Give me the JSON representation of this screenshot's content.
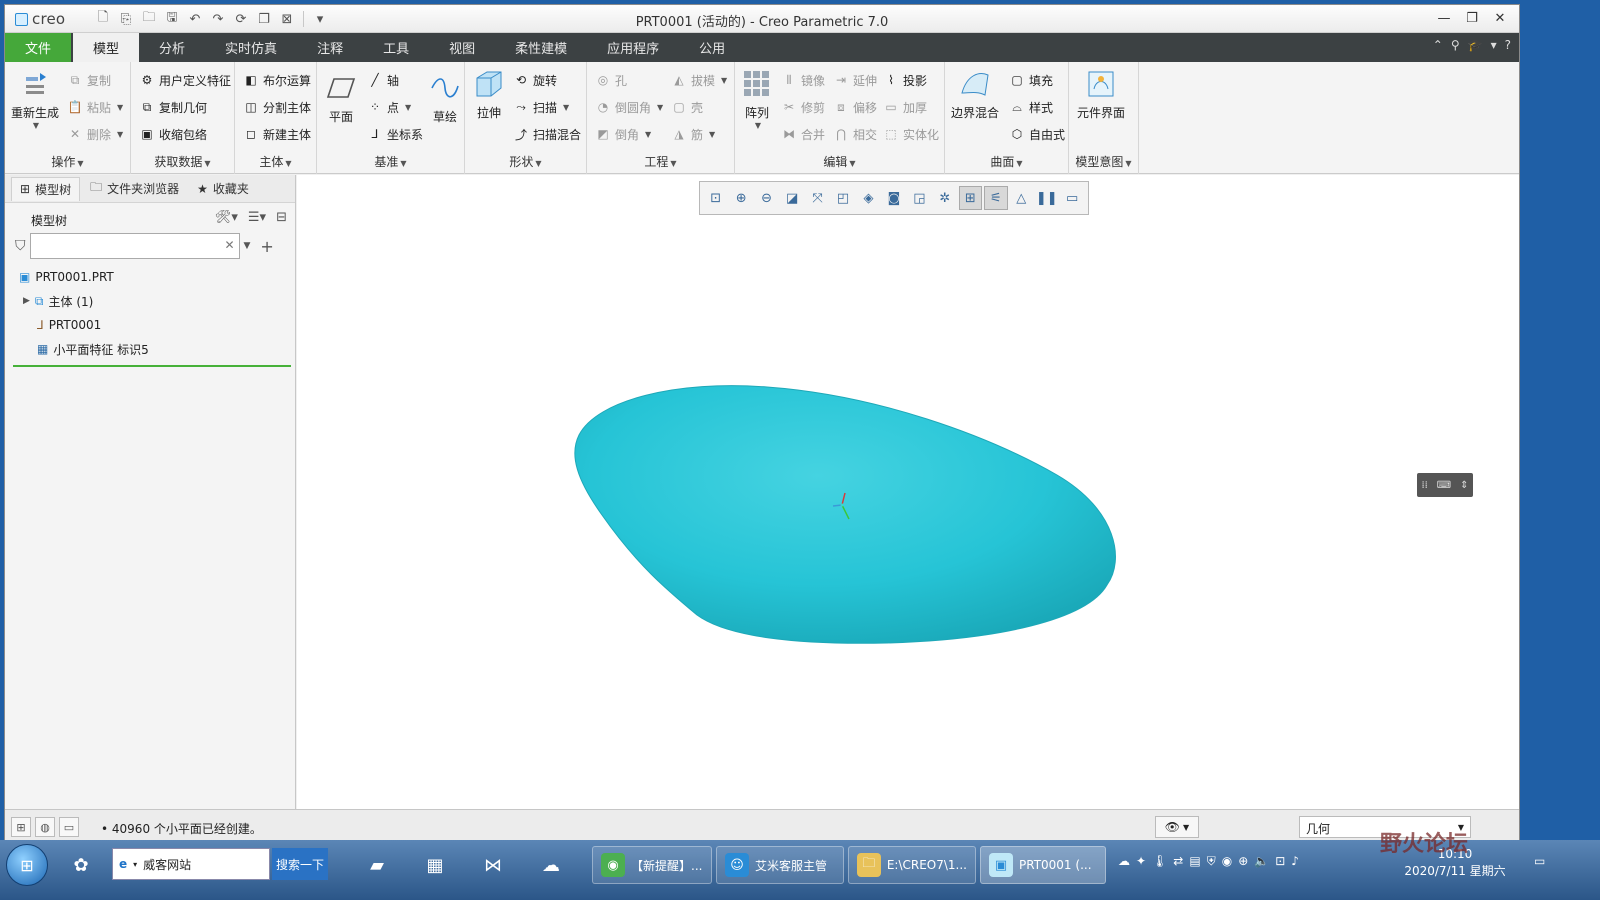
{
  "app": {
    "logo": "creo",
    "title": "PRT0001 (活动的) - Creo Parametric 7.0"
  },
  "tabs": [
    "文件",
    "模型",
    "分析",
    "实时仿真",
    "注释",
    "工具",
    "视图",
    "柔性建模",
    "应用程序",
    "公用"
  ],
  "ribbon": {
    "operations": {
      "label": "操作",
      "regenerate": "重新生成",
      "copy": "复制",
      "paste": "粘贴",
      "delete": "删除"
    },
    "get_data": {
      "label": "获取数据",
      "udf": "用户定义特征",
      "copy_geom": "复制几何",
      "shrinkwrap": "收缩包络"
    },
    "body": {
      "label": "主体",
      "boolean": "布尔运算",
      "split": "分割主体",
      "new_body": "新建主体"
    },
    "datum": {
      "label": "基准",
      "plane": "平面",
      "axis": "轴",
      "point": "点",
      "csys": "坐标系",
      "sketch": "草绘"
    },
    "shapes": {
      "label": "形状",
      "extrude": "拉伸",
      "revolve": "旋转",
      "sweep": "扫描",
      "swept_blend": "扫描混合"
    },
    "engineering": {
      "label": "工程",
      "hole": "孔",
      "round": "倒圆角",
      "chamfer": "倒角",
      "draft": "拔模",
      "shell": "壳",
      "rib": "筋"
    },
    "editing": {
      "label": "编辑",
      "pattern": "阵列",
      "mirror": "镜像",
      "trim": "修剪",
      "merge": "合并",
      "extend": "延伸",
      "offset": "偏移",
      "intersect": "相交",
      "project": "投影",
      "thicken": "加厚",
      "solidify": "实体化"
    },
    "surfaces": {
      "label": "曲面",
      "boundary_blend": "边界混合",
      "fill": "填充",
      "style": "样式",
      "freestyle": "自由式"
    },
    "model_intent": {
      "label": "模型意图",
      "component_interface": "元件界面"
    }
  },
  "left_panel": {
    "tabs": [
      "模型树",
      "文件夹浏览器",
      "收藏夹"
    ],
    "header": "模型树",
    "search_value": "",
    "tree": [
      {
        "label": "PRT0001.PRT",
        "icon": "part-icon"
      },
      {
        "label": "主体 (1)",
        "icon": "body-icon"
      },
      {
        "label": "PRT0001",
        "icon": "csys-icon"
      },
      {
        "label": "小平面特征 标识5",
        "icon": "facet-icon"
      }
    ]
  },
  "graphics": {
    "view_toolbar_icons": [
      "refit-icon",
      "zoom-in-icon",
      "zoom-out-icon",
      "repaint-icon",
      "pan-icon",
      "saved-views-icon",
      "view-manager-icon",
      "display-style-icon",
      "perspective-icon",
      "annotation-display-icon",
      "datum-display-icon",
      "spin-center-icon",
      "csys-display-icon",
      "pause-icon",
      "render-icon"
    ],
    "model_color": "#26c4d6"
  },
  "status": {
    "message": "40960 个小平面已经创建。",
    "filter": "几何"
  },
  "taskbar": {
    "address": "威客网站",
    "search_button": "搜索一下",
    "tasks": [
      "【新提醒】...",
      "艾米客服主管",
      "E:\\CREO7\\1...",
      "PRT0001 (..."
    ],
    "clock_time": "10:10",
    "clock_date": "2020/7/11 星期六"
  },
  "watermark": "野火论坛"
}
